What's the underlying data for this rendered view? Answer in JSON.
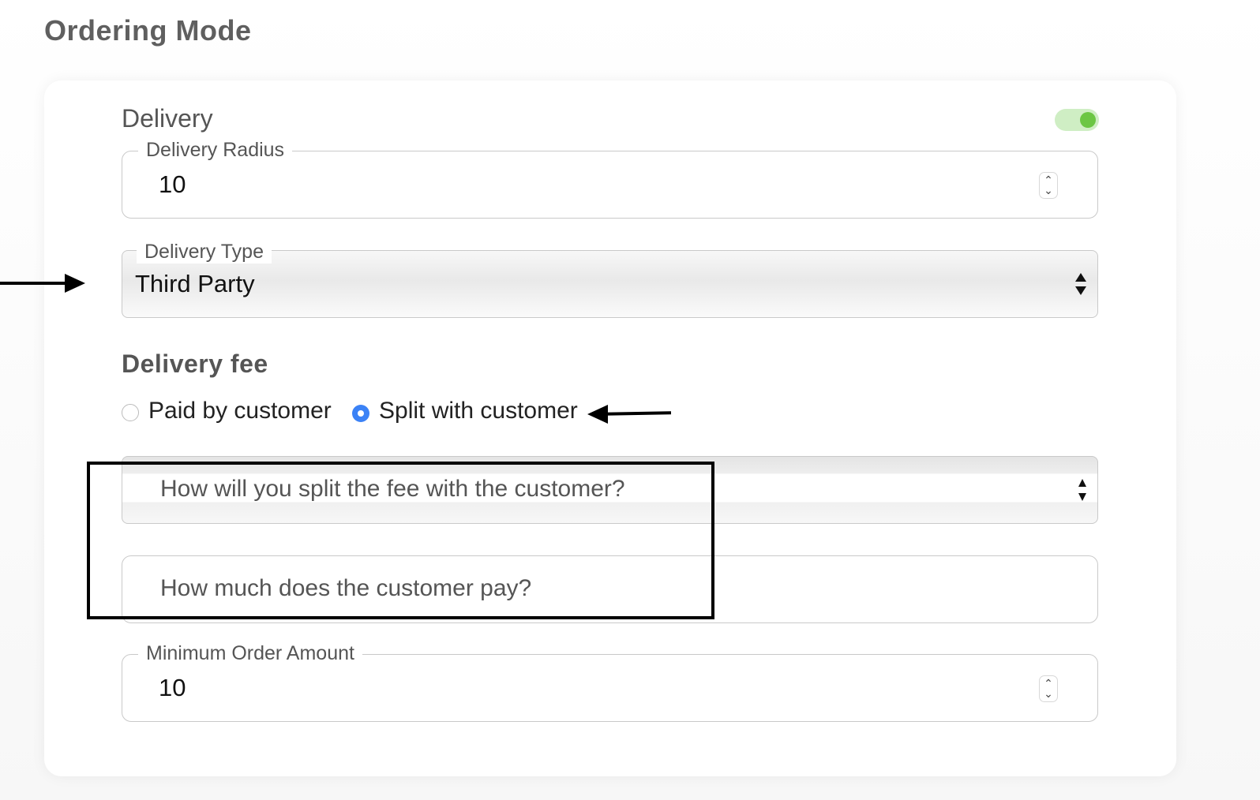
{
  "page": {
    "title": "Ordering Mode"
  },
  "delivery": {
    "label": "Delivery",
    "enabled": true,
    "toggle_color": "#6cc644",
    "radius": {
      "label": "Delivery Radius",
      "value": "10"
    },
    "type": {
      "label": "Delivery Type",
      "value": "Third Party"
    },
    "fee": {
      "title": "Delivery fee",
      "options": [
        {
          "label": "Paid by customer",
          "selected": false
        },
        {
          "label": "Split with customer",
          "selected": true
        }
      ],
      "split_placeholder": "How will you split the fee with the customer?",
      "customer_pays_placeholder": "How much does the customer pay?"
    },
    "min_order": {
      "label": "Minimum Order Amount",
      "value": "10"
    }
  },
  "colors": {
    "accent": "#3b82f6",
    "toggle_track": "#cfeec4"
  }
}
